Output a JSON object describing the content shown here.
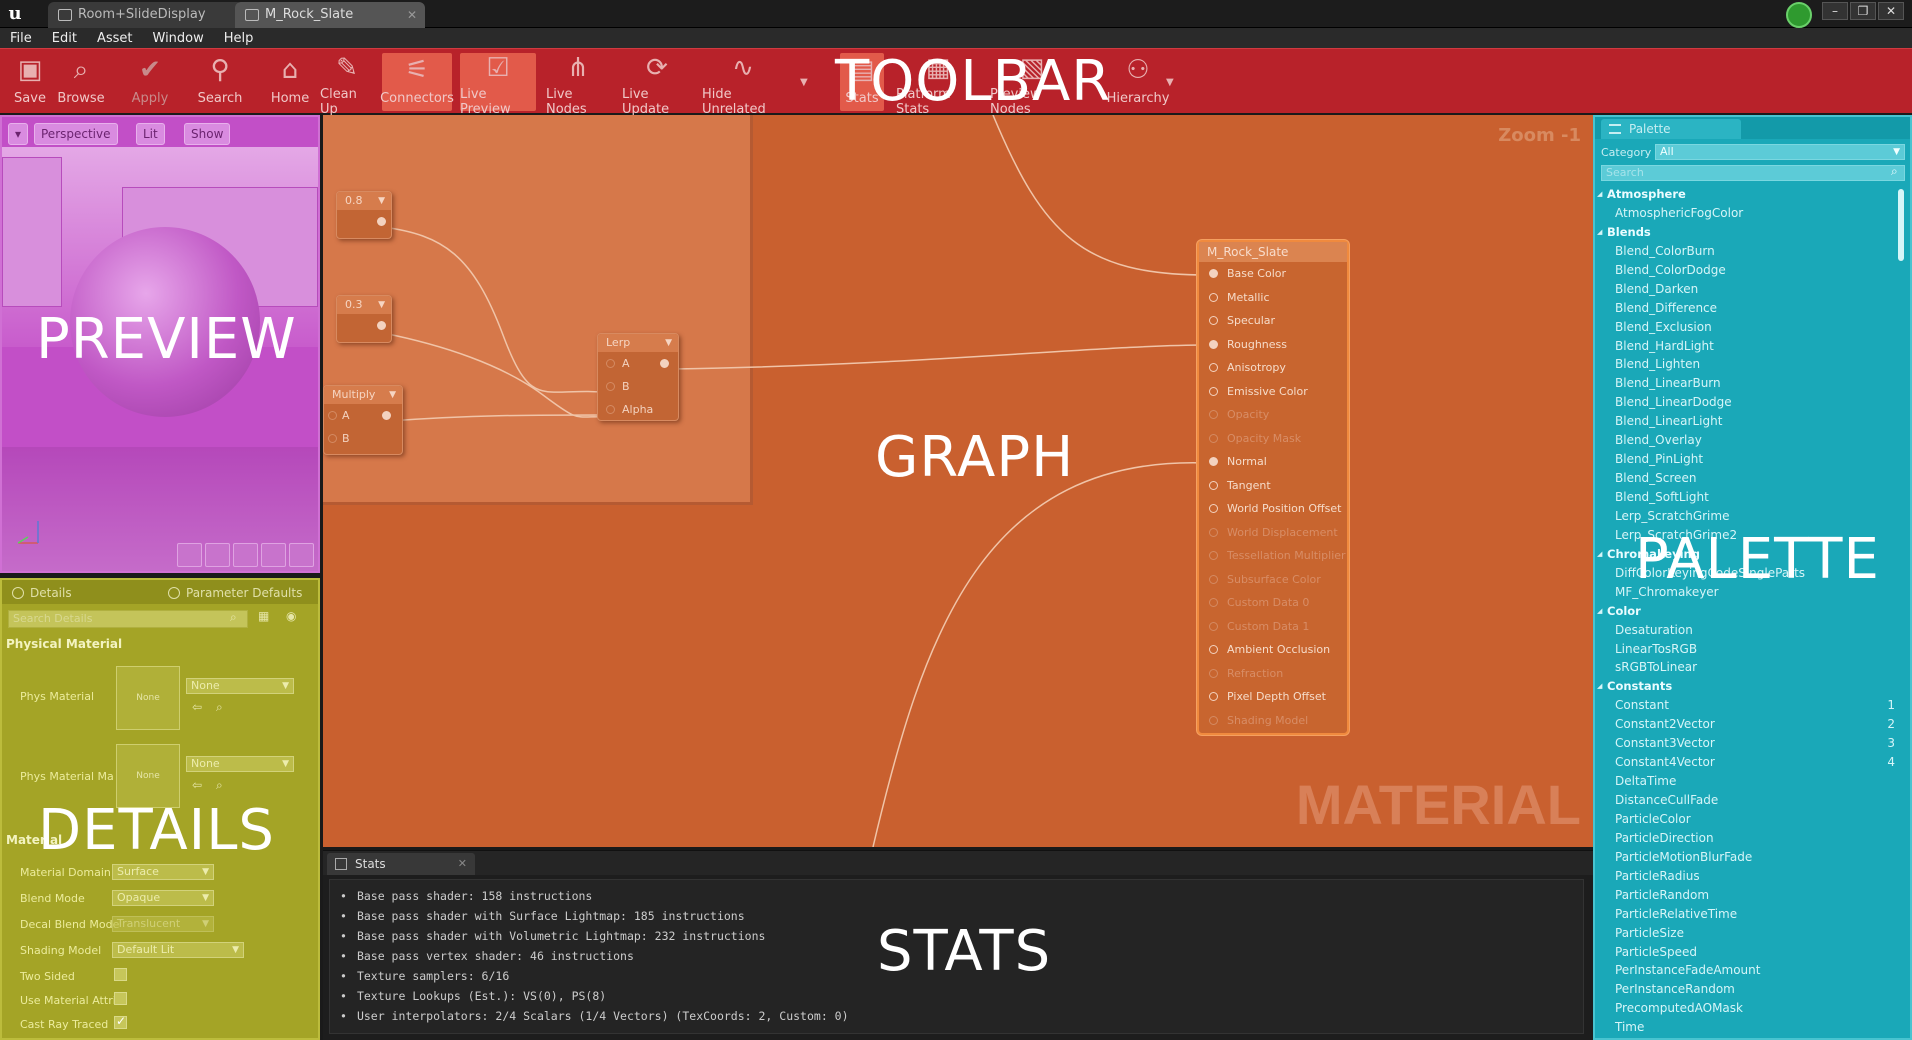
{
  "window": {
    "tabs": [
      {
        "label": "Room+SlideDisplay"
      },
      {
        "label": "M_Rock_Slate"
      }
    ]
  },
  "menu": [
    "File",
    "Edit",
    "Asset",
    "Window",
    "Help"
  ],
  "toolbar": {
    "buttons": [
      {
        "label": "Save",
        "icon": "save-icon"
      },
      {
        "label": "Browse",
        "icon": "browse-icon"
      },
      {
        "label": "Apply",
        "icon": "apply-icon"
      },
      {
        "label": "Search",
        "icon": "binoculars-icon"
      },
      {
        "label": "Home",
        "icon": "home-icon"
      },
      {
        "label": "Clean Up",
        "icon": "broom-icon"
      },
      {
        "label": "Connectors",
        "icon": "connectors-icon"
      },
      {
        "label": "Live Preview",
        "icon": "live-preview-icon"
      },
      {
        "label": "Live Nodes",
        "icon": "live-nodes-icon"
      },
      {
        "label": "Live Update",
        "icon": "live-update-icon"
      },
      {
        "label": "Hide Unrelated",
        "icon": "hide-unrelated-icon"
      },
      {
        "label": "Stats",
        "icon": "stats-icon"
      },
      {
        "label": "Platform Stats",
        "icon": "platform-stats-icon"
      },
      {
        "label": "Preview Nodes",
        "icon": "preview-nodes-icon"
      },
      {
        "label": "Hierarchy",
        "icon": "hierarchy-icon"
      }
    ]
  },
  "overlays": {
    "toolbar": "TOOLBAR",
    "preview": "PREVIEW",
    "graph": "GRAPH",
    "palette": "PALETTE",
    "details": "DETAILS",
    "stats": "STATS"
  },
  "preview": {
    "menu_btn": "▾",
    "perspective": "Perspective",
    "lit": "Lit",
    "show": "Show"
  },
  "details": {
    "tabs": [
      "Details",
      "Parameter Defaults"
    ],
    "search_placeholder": "Search Details",
    "section_physical": "Physical Material",
    "phys_material_label": "Phys Material",
    "phys_material_mask_label": "Phys Material Ma",
    "thumb_none": "None",
    "combo_none": "None",
    "section_material": "Material",
    "rows": [
      {
        "label": "Material Domain",
        "value": "Surface"
      },
      {
        "label": "Blend Mode",
        "value": "Opaque"
      },
      {
        "label": "Decal Blend Mode",
        "value": "Translucent"
      },
      {
        "label": "Shading Model",
        "value": "Default Lit"
      }
    ],
    "checks": [
      {
        "label": "Two Sided",
        "checked": false
      },
      {
        "label": "Use Material Attri",
        "checked": false
      },
      {
        "label": "Cast Ray Traced",
        "checked": true
      }
    ]
  },
  "graph": {
    "zoom": "Zoom -1",
    "watermark": "MATERIAL",
    "nodes": {
      "const1": "0.8",
      "const2": "0.3",
      "multiply": "Multiply",
      "multiply_pins": [
        "A",
        "B"
      ],
      "lerp": "Lerp",
      "lerp_pins": [
        "A",
        "B",
        "Alpha"
      ]
    },
    "material_node": {
      "title": "M_Rock_Slate",
      "pins": [
        {
          "label": "Base Color",
          "active": true,
          "connected": true
        },
        {
          "label": "Metallic",
          "active": true,
          "connected": false
        },
        {
          "label": "Specular",
          "active": true,
          "connected": false
        },
        {
          "label": "Roughness",
          "active": true,
          "connected": true
        },
        {
          "label": "Anisotropy",
          "active": true,
          "connected": false
        },
        {
          "label": "Emissive Color",
          "active": true,
          "connected": false
        },
        {
          "label": "Opacity",
          "active": false,
          "connected": false
        },
        {
          "label": "Opacity Mask",
          "active": false,
          "connected": false
        },
        {
          "label": "Normal",
          "active": true,
          "connected": true
        },
        {
          "label": "Tangent",
          "active": true,
          "connected": false
        },
        {
          "label": "World Position Offset",
          "active": true,
          "connected": false
        },
        {
          "label": "World Displacement",
          "active": false,
          "connected": false
        },
        {
          "label": "Tessellation Multiplier",
          "active": false,
          "connected": false
        },
        {
          "label": "Subsurface Color",
          "active": false,
          "connected": false
        },
        {
          "label": "Custom Data 0",
          "active": false,
          "connected": false
        },
        {
          "label": "Custom Data 1",
          "active": false,
          "connected": false
        },
        {
          "label": "Ambient Occlusion",
          "active": true,
          "connected": false
        },
        {
          "label": "Refraction",
          "active": false,
          "connected": false
        },
        {
          "label": "Pixel Depth Offset",
          "active": true,
          "connected": false
        },
        {
          "label": "Shading Model",
          "active": false,
          "connected": false
        }
      ]
    }
  },
  "stats": {
    "tab": "Stats",
    "lines": [
      "Base pass shader: 158 instructions",
      "Base pass shader with Surface Lightmap: 185 instructions",
      "Base pass shader with Volumetric Lightmap: 232 instructions",
      "Base pass vertex shader: 46 instructions",
      "Texture samplers: 6/16",
      "Texture Lookups (Est.): VS(0), PS(8)",
      "User interpolators: 2/4 Scalars (1/4 Vectors) (TexCoords: 2, Custom: 0)"
    ]
  },
  "palette": {
    "tab": "Palette",
    "category_label": "Category",
    "category_value": "All",
    "search_placeholder": "Search",
    "items": [
      {
        "label": "Atmosphere",
        "cat": true
      },
      {
        "label": "AtmosphericFogColor"
      },
      {
        "label": "Blends",
        "cat": true
      },
      {
        "label": "Blend_ColorBurn"
      },
      {
        "label": "Blend_ColorDodge"
      },
      {
        "label": "Blend_Darken"
      },
      {
        "label": "Blend_Difference"
      },
      {
        "label": "Blend_Exclusion"
      },
      {
        "label": "Blend_HardLight"
      },
      {
        "label": "Blend_Lighten"
      },
      {
        "label": "Blend_LinearBurn"
      },
      {
        "label": "Blend_LinearDodge"
      },
      {
        "label": "Blend_LinearLight"
      },
      {
        "label": "Blend_Overlay"
      },
      {
        "label": "Blend_PinLight"
      },
      {
        "label": "Blend_Screen"
      },
      {
        "label": "Blend_SoftLight"
      },
      {
        "label": "Lerp_ScratchGrime"
      },
      {
        "label": "Lerp_ScratchGrime2"
      },
      {
        "label": "Chromakeying",
        "cat": true
      },
      {
        "label": "DiffColorKeyingCodeSingleParts"
      },
      {
        "label": "MF_Chromakeyer"
      },
      {
        "label": "Color",
        "cat": true
      },
      {
        "label": "Desaturation"
      },
      {
        "label": "LinearTosRGB"
      },
      {
        "label": "sRGBToLinear"
      },
      {
        "label": "Constants",
        "cat": true
      },
      {
        "label": "Constant",
        "hotkey": "1"
      },
      {
        "label": "Constant2Vector",
        "hotkey": "2"
      },
      {
        "label": "Constant3Vector",
        "hotkey": "3"
      },
      {
        "label": "Constant4Vector",
        "hotkey": "4"
      },
      {
        "label": "DeltaTime"
      },
      {
        "label": "DistanceCullFade"
      },
      {
        "label": "ParticleColor"
      },
      {
        "label": "ParticleDirection"
      },
      {
        "label": "ParticleMotionBlurFade"
      },
      {
        "label": "ParticleRadius"
      },
      {
        "label": "ParticleRandom"
      },
      {
        "label": "ParticleRelativeTime"
      },
      {
        "label": "ParticleSize"
      },
      {
        "label": "ParticleSpeed"
      },
      {
        "label": "PerInstanceFadeAmount"
      },
      {
        "label": "PerInstanceRandom"
      },
      {
        "label": "PrecomputedAOMask"
      },
      {
        "label": "Time"
      }
    ]
  },
  "colors": {
    "toolbar": "#b8222a",
    "preview": "#c24fc7",
    "details": "#a4a426",
    "graph": "#c9602f",
    "palette": "#1aa8b8",
    "stats": "#1d1d1d"
  }
}
